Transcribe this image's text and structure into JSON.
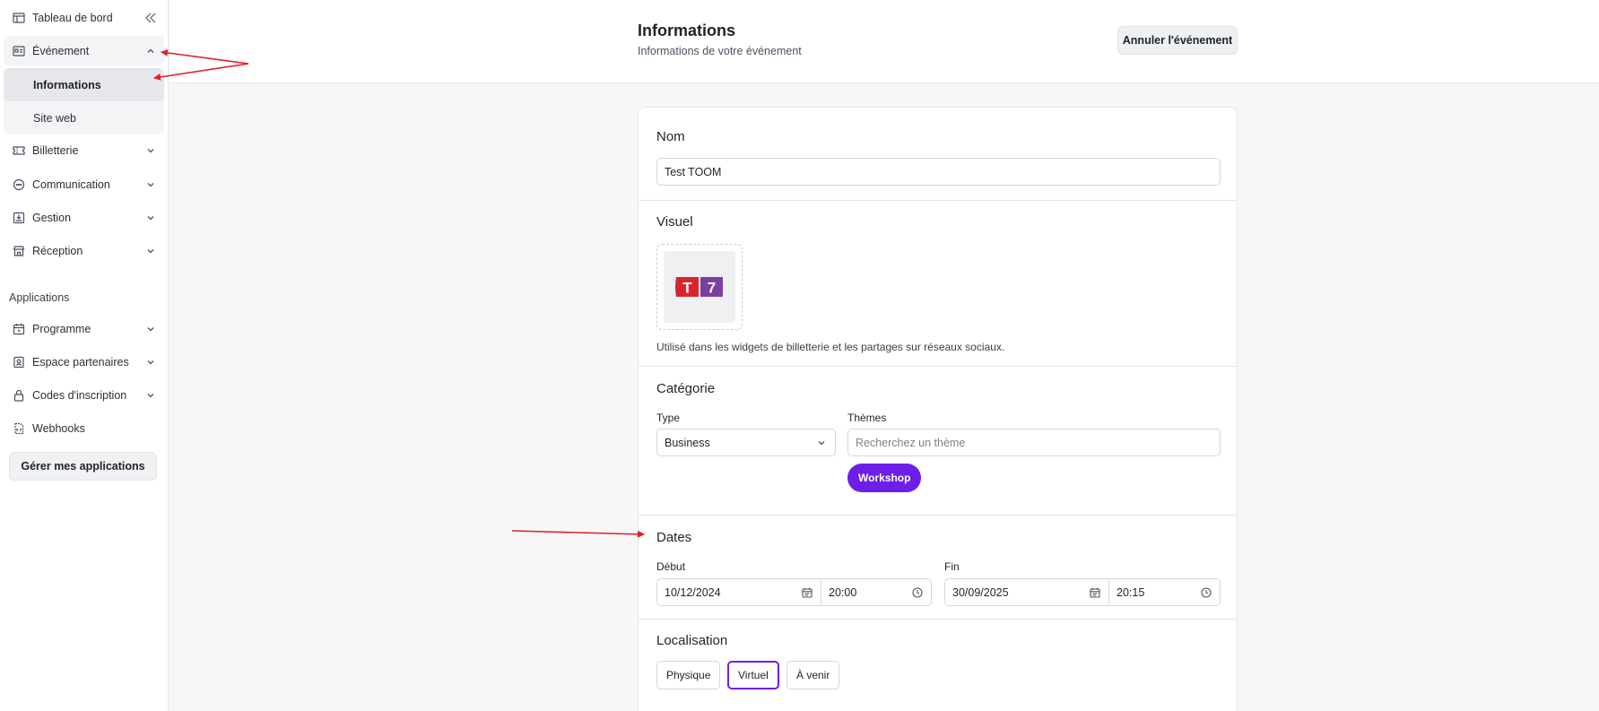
{
  "sidebar": {
    "items": [
      {
        "label": "Tableau de bord",
        "icon": "layout-icon"
      },
      {
        "label": "Événement",
        "icon": "event-card-icon"
      },
      {
        "label": "Billetterie",
        "icon": "ticket-icon"
      },
      {
        "label": "Communication",
        "icon": "chat-icon"
      },
      {
        "label": "Gestion",
        "icon": "inbox-download-icon"
      },
      {
        "label": "Réception",
        "icon": "store-icon"
      }
    ],
    "event_subitems": [
      "Informations",
      "Site web"
    ],
    "apps_label": "Applications",
    "apps": [
      {
        "label": "Programme",
        "icon": "calendar-icon"
      },
      {
        "label": "Espace partenaires",
        "icon": "badge-icon"
      },
      {
        "label": "Codes d'inscription",
        "icon": "lock-icon"
      },
      {
        "label": "Webhooks",
        "icon": "code-file-icon"
      }
    ],
    "manage_apps": "Gérer mes applications"
  },
  "header": {
    "title": "Informations",
    "subtitle": "Informations de votre événement",
    "cancel_button": "Annuler l'événement"
  },
  "form": {
    "name": {
      "title": "Nom",
      "value": "Test TOOM"
    },
    "visual": {
      "title": "Visuel",
      "logo_left": "T",
      "logo_right": "7",
      "help": "Utilisé dans les widgets de billetterie et les partages sur réseaux sociaux."
    },
    "category": {
      "title": "Catégorie",
      "type_label": "Type",
      "type_value": "Business",
      "themes_label": "Thèmes",
      "themes_placeholder": "Recherchez un thème",
      "selected_tag": "Workshop"
    },
    "dates": {
      "title": "Dates",
      "start_label": "Début",
      "start_date": "10/12/2024",
      "start_time": "20:00",
      "end_label": "Fin",
      "end_date": "30/09/2025",
      "end_time": "20:15"
    },
    "location": {
      "title": "Localisation",
      "options": [
        "Physique",
        "Virtuel",
        "À venir"
      ],
      "selected": "Virtuel"
    }
  },
  "colors": {
    "accent": "#6d1fe8",
    "annotation_arrow": "#e0202a",
    "logo_red": "#d7262b",
    "logo_purple": "#7b3fa0"
  }
}
